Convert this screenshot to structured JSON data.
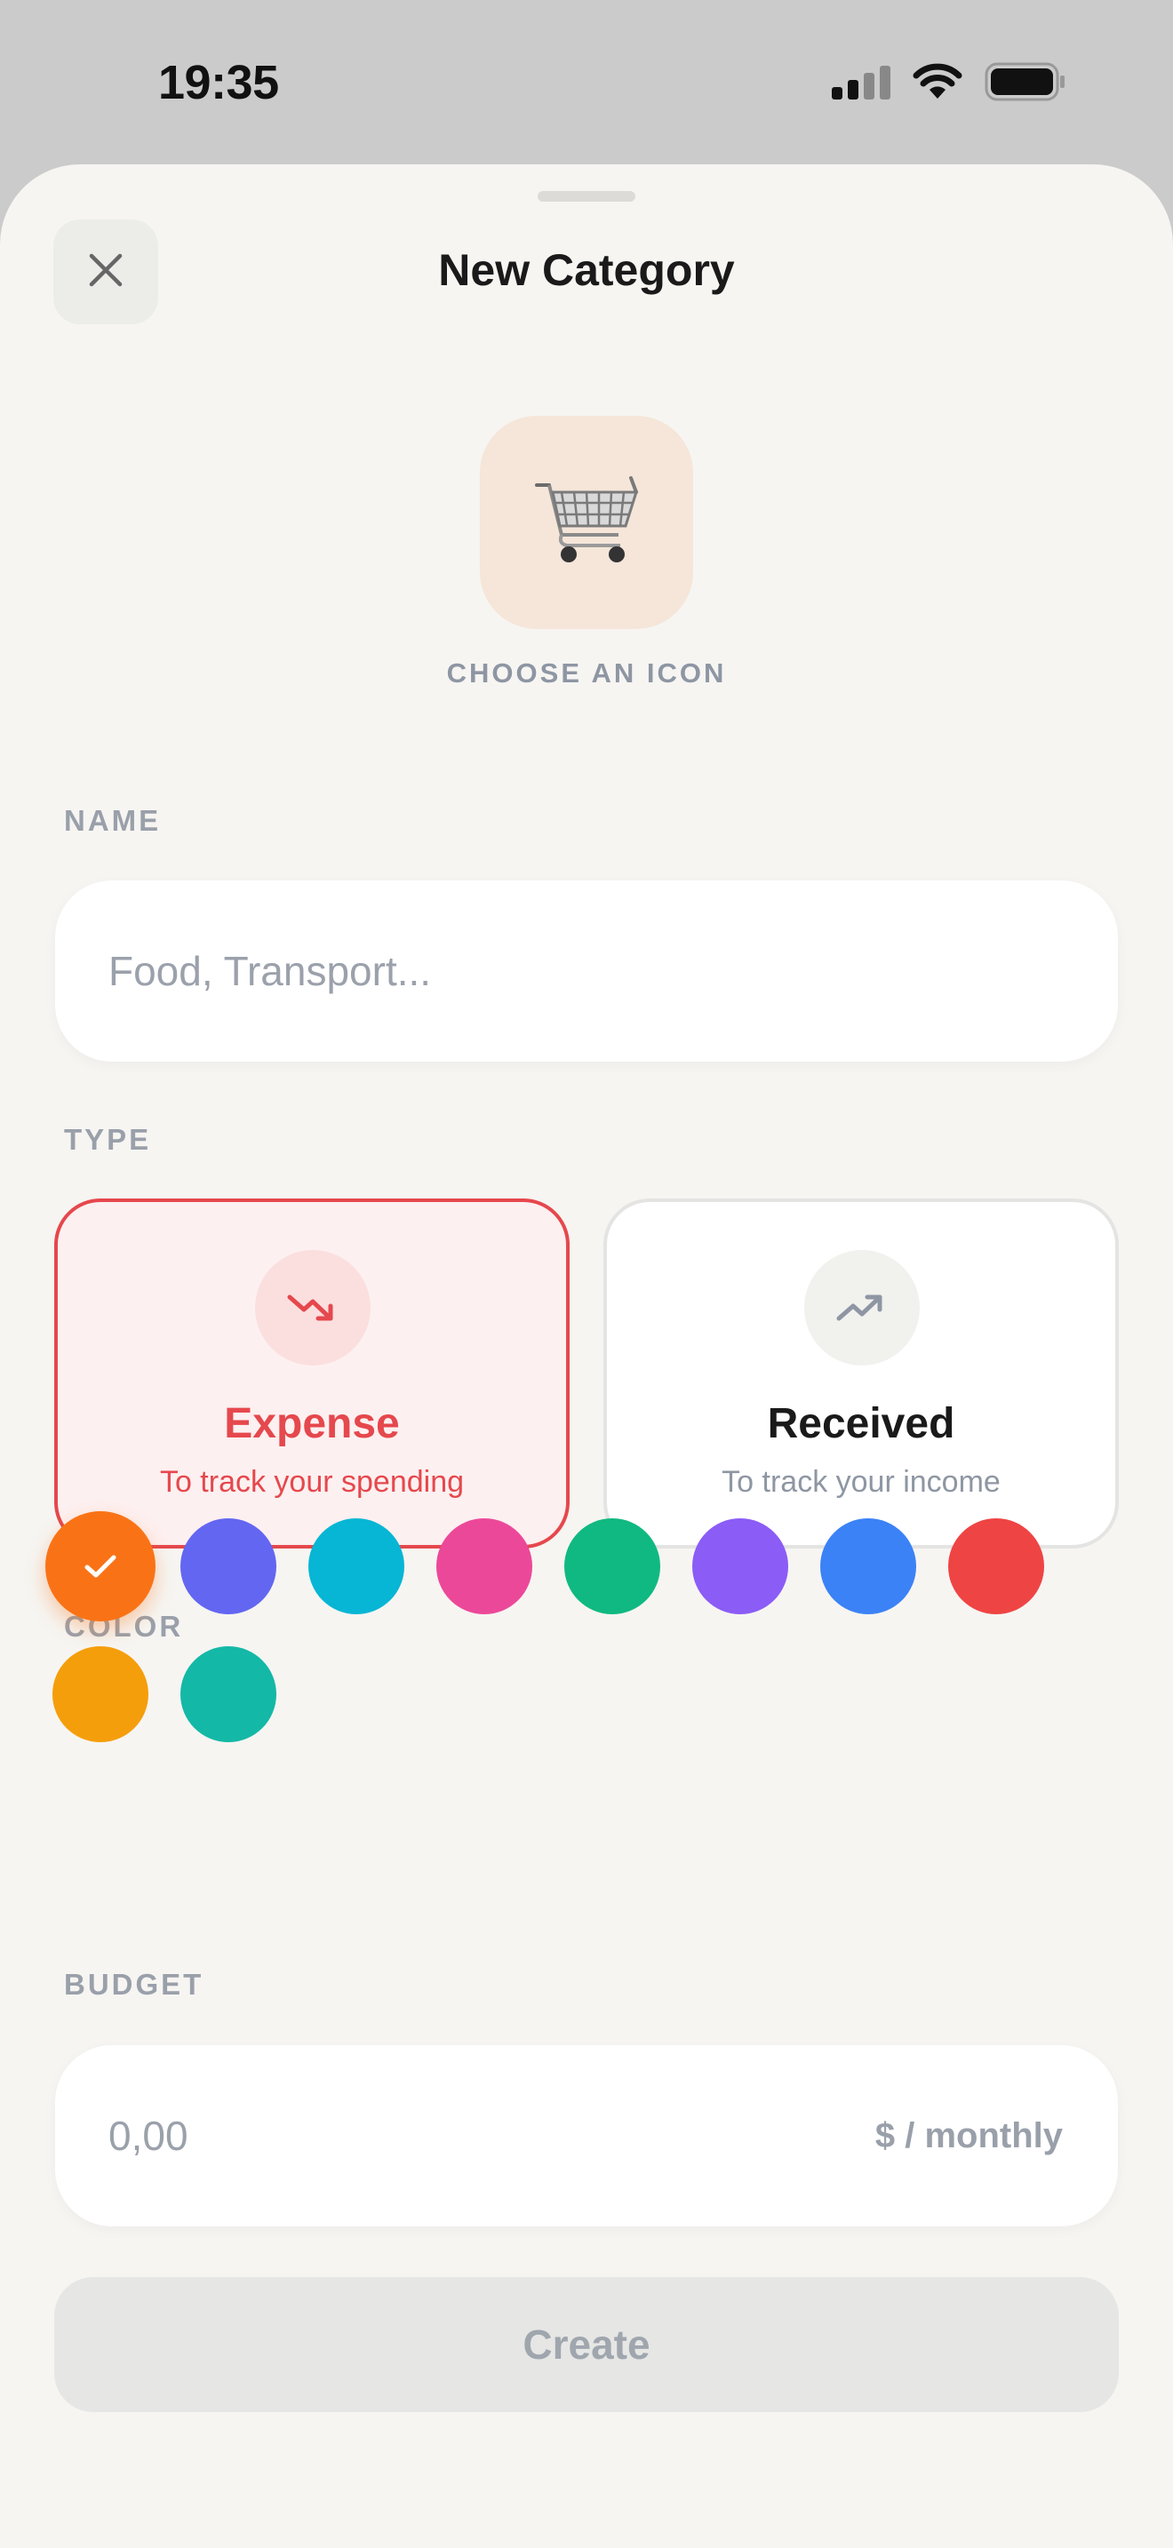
{
  "status_bar": {
    "time": "19:35"
  },
  "sheet": {
    "title": "New Category",
    "close_icon": "close-icon"
  },
  "icon_picker": {
    "emoji": "🛒",
    "label": "CHOOSE AN ICON",
    "background": "#f5e6d9"
  },
  "name": {
    "label": "NAME",
    "placeholder": "Food, Transport...",
    "value": ""
  },
  "type": {
    "label": "TYPE",
    "options": [
      {
        "title": "Expense",
        "subtitle": "To track your spending",
        "icon": "trending-down-icon",
        "selected": true,
        "accent": "#e5484d"
      },
      {
        "title": "Received",
        "subtitle": "To track your income",
        "icon": "trending-up-icon",
        "selected": false,
        "accent": "#8e96a3"
      }
    ]
  },
  "color": {
    "label": "COLOR",
    "selected_index": 0,
    "swatches": [
      "#f97316",
      "#6366f1",
      "#06b6d4",
      "#ec4899",
      "#10b981",
      "#8b5cf6",
      "#3b82f6",
      "#ef4444",
      "#f59e0b",
      "#14b8a6"
    ]
  },
  "budget": {
    "label": "BUDGET",
    "placeholder": "0,00",
    "value": "",
    "suffix": "$ / monthly"
  },
  "actions": {
    "create_label": "Create"
  }
}
